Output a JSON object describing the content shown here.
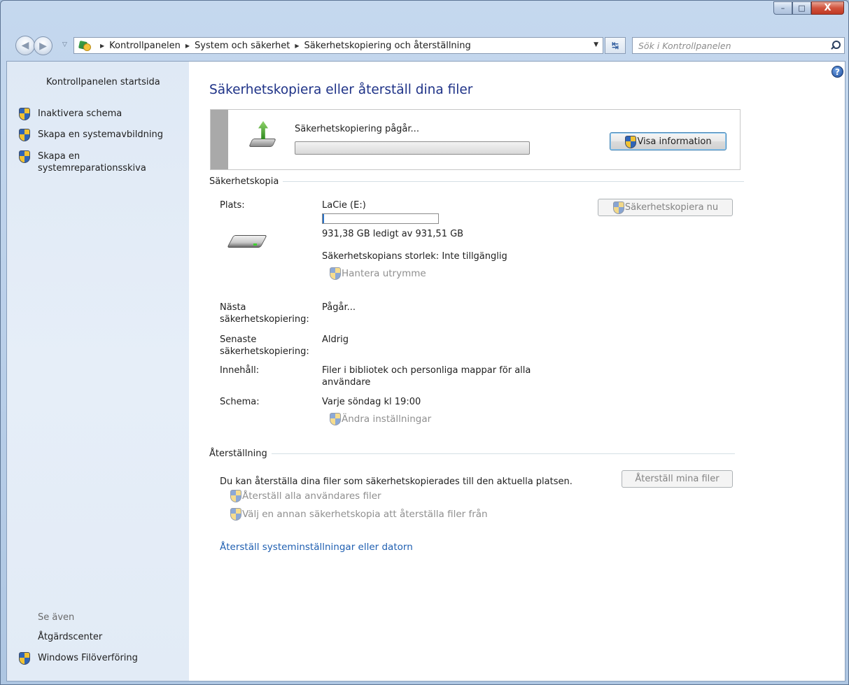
{
  "window": {
    "caption_buttons": {
      "minimize": "–",
      "maximize": "□",
      "close": "X"
    }
  },
  "address": {
    "crumbs": [
      "Kontrollpanelen",
      "System och säkerhet",
      "Säkerhetskopiering och återställning"
    ],
    "search_placeholder": "Sök i Kontrollpanelen"
  },
  "sidebar": {
    "home": "Kontrollpanelen startsida",
    "items": [
      {
        "label": "Inaktivera schema",
        "icon": "uac-shield-icon"
      },
      {
        "label": "Skapa en systemavbildning",
        "icon": "uac-shield-icon"
      },
      {
        "label": "Skapa en systemreparationsskiva",
        "icon": "uac-shield-icon"
      }
    ],
    "see_also": "Se även",
    "see_also_items": [
      {
        "label": "Åtgärdscenter"
      },
      {
        "label": "Windows Filöverföring",
        "icon": "uac-shield-icon"
      }
    ]
  },
  "main": {
    "title": "Säkerhetskopiera eller återställ dina filer",
    "progress": {
      "label": "Säkerhetskopiering pågår...",
      "fraction": 0,
      "button": "Visa information"
    },
    "backup_section": {
      "heading": "Säkerhetskopia",
      "location_label": "Plats:",
      "location_value": "LaCie (E:)",
      "space_used_fraction": 0.0014,
      "space_text": "931,38 GB ledigt av 931,51 GB",
      "size_text": "Säkerhetskopians storlek: Inte tillgänglig",
      "manage_space": "Hantera utrymme",
      "backup_now_button": "Säkerhetskopiera nu",
      "next_label": "Nästa säkerhetskopiering:",
      "next_value": "Pågår...",
      "last_label": "Senaste säkerhetskopiering:",
      "last_value": "Aldrig",
      "contents_label": "Innehåll:",
      "contents_value": "Filer i bibliotek och personliga mappar för alla användare",
      "schedule_label": "Schema:",
      "schedule_value": "Varje söndag kl 19:00",
      "change_settings": "Ändra inställningar"
    },
    "restore_section": {
      "heading": "Återställning",
      "description": "Du kan återställa dina filer som säkerhetskopierades till den aktuella platsen.",
      "restore_button": "Återställ mina filer",
      "restore_all_users": "Återställ alla användares filer",
      "choose_other": "Välj en annan säkerhetskopia att återställa filer från",
      "system_restore_link": "Återställ systeminställningar eller datorn"
    }
  },
  "colors": {
    "title_blue": "#1e3287",
    "link_blue": "#1f5fb1",
    "disabled_gray": "#8f8f8f",
    "sidebar_bg": "#e2ebf6"
  }
}
